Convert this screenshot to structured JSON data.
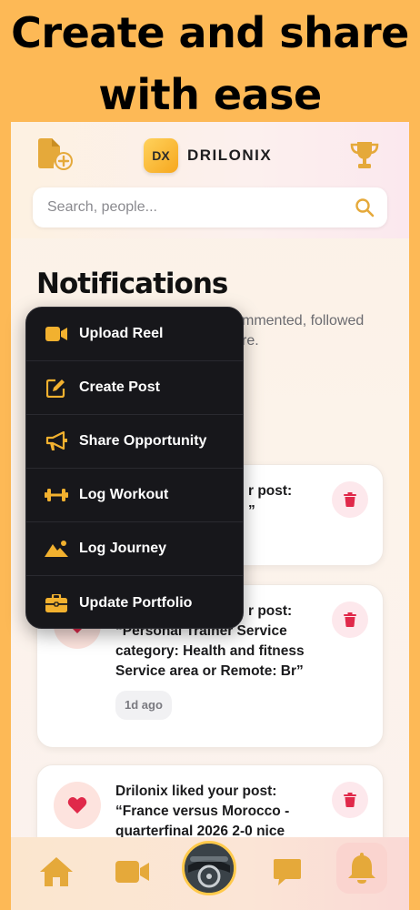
{
  "headline": {
    "line1": "Create and share",
    "line2": "with ease"
  },
  "header": {
    "brand_logo_text": "DX",
    "brand_name": "DRILONIX"
  },
  "search": {
    "placeholder": "Search, people..."
  },
  "notifications": {
    "title": "Notifications",
    "subtitle_visible": "mmented, followed",
    "subtitle_line2_visible": "re."
  },
  "cards": [
    {
      "text_line1": "r post:",
      "text_line2": "”",
      "time": ""
    },
    {
      "text_line1": "r post:",
      "text_body": "“Personal Trainer Service category: Health and fitness Service area or Remote: Br”",
      "time": "1d ago"
    },
    {
      "text_line1": "Drilonix liked your post:",
      "text_body": "“France versus Morocco - quarterfinal 2026 2-0 nice"
    }
  ],
  "menu": {
    "items": [
      {
        "label": "Upload Reel",
        "icon": "video-icon"
      },
      {
        "label": "Create Post",
        "icon": "edit-icon"
      },
      {
        "label": "Share Opportunity",
        "icon": "megaphone-icon"
      },
      {
        "label": "Log Workout",
        "icon": "dumbbell-icon"
      },
      {
        "label": "Log Journey",
        "icon": "mountain-icon"
      },
      {
        "label": "Update Portfolio",
        "icon": "briefcase-icon"
      }
    ]
  },
  "nav": {
    "items": [
      "home-icon",
      "video-icon",
      "profile-avatar",
      "chat-icon",
      "bell-icon"
    ],
    "active": "bell-icon"
  },
  "colors": {
    "accent": "#F2B12F",
    "background": "#FDB956",
    "menu_bg": "#17171b",
    "delete": "#E0294A"
  }
}
